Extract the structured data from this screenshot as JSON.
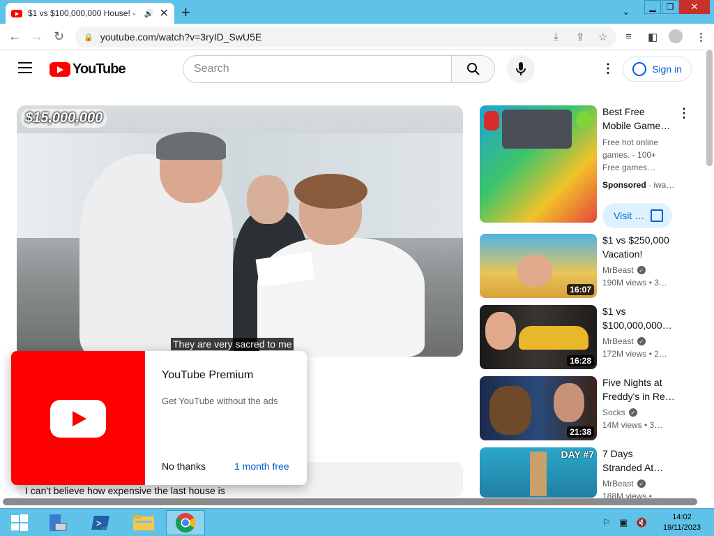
{
  "browser": {
    "tab_title": "$1 vs $100,000,000 House! -",
    "url": "youtube.com/watch?v=3ryID_SwU5E",
    "new_tab_label": "+",
    "window_buttons": {
      "minimize": "▁",
      "restore": "❐",
      "close": "✕"
    }
  },
  "youtube": {
    "logo_text": "YouTube",
    "search_placeholder": "Search",
    "sign_in_label": "Sign in"
  },
  "player": {
    "overlay_text": "$15,000,000",
    "caption": "They are very sacred to me"
  },
  "premium_popup": {
    "title": "YouTube Premium",
    "subtitle": "Get YouTube without the ads",
    "dismiss_label": "No thanks",
    "cta_label": "1 month free"
  },
  "comment_preview": "I can't believe how expensive the last house is",
  "ad": {
    "title": "Best Free Mobile Game…",
    "description": "Free hot online games. - 100+ Free games…",
    "sponsored_label": "Sponsored",
    "advertiser": "· iwa…",
    "visit_label": "Visit …"
  },
  "recommendations": [
    {
      "title": "$1 vs $250,000 Vacation!",
      "channel": "MrBeast",
      "meta": "190M views • 3…",
      "duration": "16:07"
    },
    {
      "title": "$1 vs $100,000,000…",
      "channel": "MrBeast",
      "meta": "172M views • 2…",
      "duration": "16:28"
    },
    {
      "title": "Five Nights at Freddy's in Re…",
      "channel": "Socks",
      "meta": "14M views • 3…",
      "duration": "21:38"
    },
    {
      "title": "7 Days Stranded At…",
      "channel": "MrBeast",
      "meta": "188M views • …",
      "duration": "",
      "badge": "DAY #7"
    }
  ],
  "taskbar": {
    "time": "14:02",
    "date": "19/11/2023"
  },
  "colors": {
    "youtube_red": "#ff0000",
    "link_blue": "#065fd4",
    "chrome_frame": "#5fc2e8"
  }
}
